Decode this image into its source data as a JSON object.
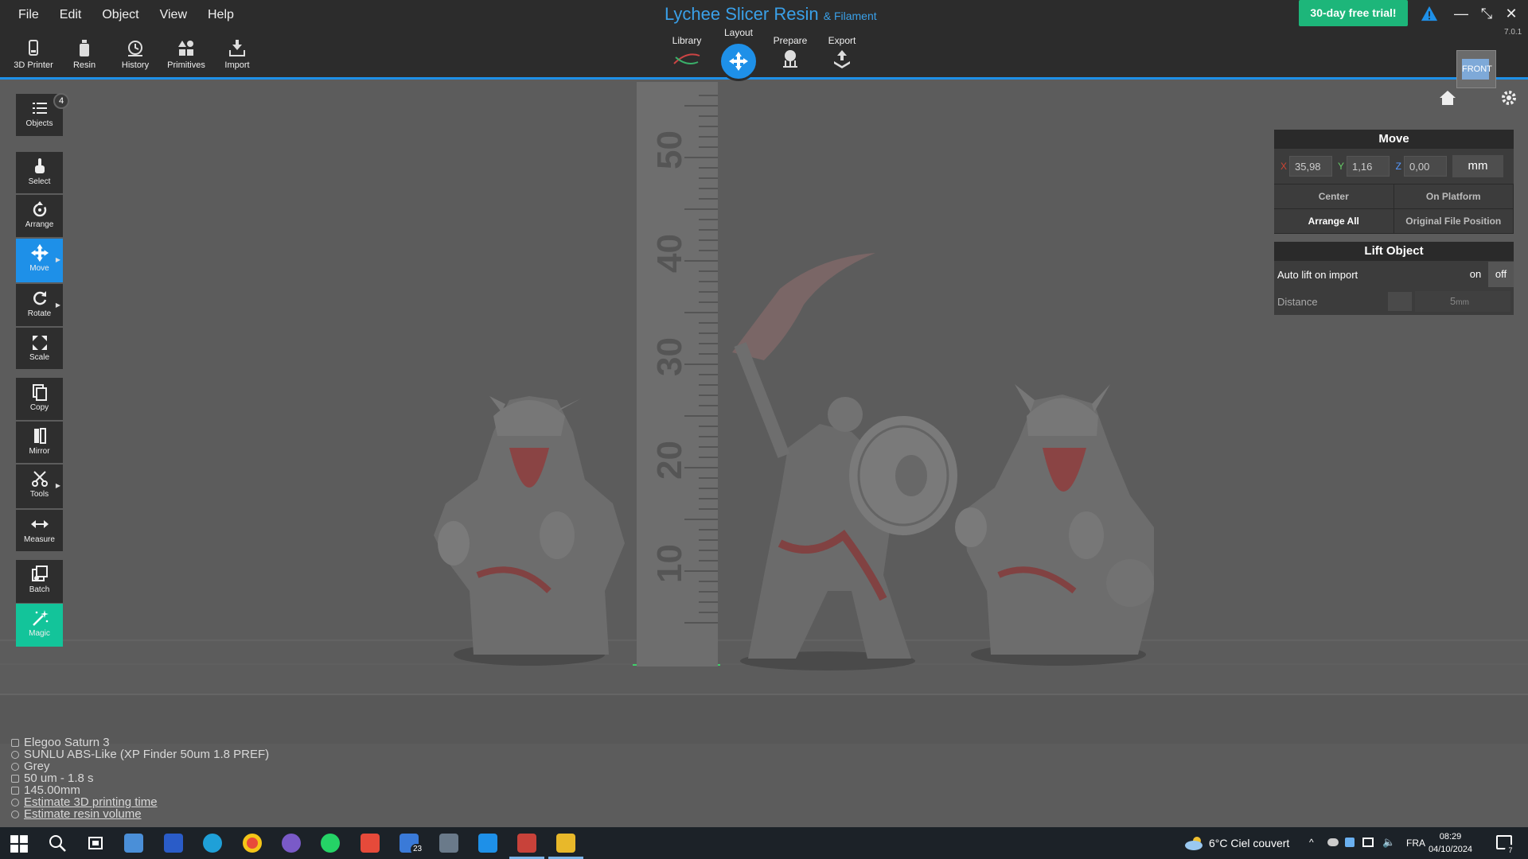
{
  "menu": [
    "File",
    "Edit",
    "Object",
    "View",
    "Help"
  ],
  "app": {
    "title": "Lychee Slicer Resin",
    "title_sub": "& Filament",
    "version": "7.0.1",
    "trial_label": "30-day free trial!"
  },
  "top_tools": [
    {
      "label": "3D Printer",
      "icon": "printer-icon"
    },
    {
      "label": "Resin",
      "icon": "resin-bottle-icon"
    },
    {
      "label": "History",
      "icon": "history-icon"
    },
    {
      "label": "Primitives",
      "icon": "primitives-icon"
    },
    {
      "label": "Import",
      "icon": "import-icon"
    }
  ],
  "workflow": {
    "library": "Library",
    "layout": "Layout",
    "prepare": "Prepare",
    "export": "Export",
    "active": "Layout"
  },
  "view_cube": {
    "face": "FRONT"
  },
  "left_tools": {
    "objects": "Objects",
    "objects_count": "4",
    "select": "Select",
    "arrange": "Arrange",
    "move": "Move",
    "rotate": "Rotate",
    "scale": "Scale",
    "copy": "Copy",
    "mirror": "Mirror",
    "tools": "Tools",
    "measure": "Measure",
    "batch": "Batch",
    "magic": "Magic"
  },
  "move_panel": {
    "title": "Move",
    "x": "35,98",
    "y": "1,16",
    "z": "0,00",
    "x_label": "X",
    "y_label": "Y",
    "z_label": "Z",
    "unit": "mm",
    "center": "Center",
    "on_platform": "On Platform",
    "arrange_all": "Arrange All",
    "original_position": "Original File Position"
  },
  "lift_panel": {
    "title": "Lift Object",
    "auto_lift_label": "Auto lift on import",
    "on": "on",
    "off": "off",
    "auto_lift_state": "off",
    "distance_label": "Distance",
    "distance_value": "5",
    "distance_unit": "mm"
  },
  "ruler_labels": [
    "50",
    "40",
    "30",
    "20",
    "10"
  ],
  "info": {
    "printer": "Elegoo Saturn 3",
    "resin": "SUNLU ABS-Like (XP Finder 50um 1.8 PREF)",
    "color": "Grey",
    "layer": "50 um - 1.8 s",
    "height": "145.00mm",
    "estimate_time": "Estimate 3D printing time",
    "estimate_volume": "Estimate resin volume"
  },
  "taskbar": {
    "weather": "6°C  Ciel couvert",
    "lang": "FRA",
    "time": "08:29",
    "date": "04/10/2024",
    "mail_badge": "23",
    "notif_badge": "7"
  },
  "colors": {
    "accent": "#1e90e8",
    "trial": "#1db67a",
    "magic": "#13c49a",
    "highlight": "#c0282a"
  }
}
